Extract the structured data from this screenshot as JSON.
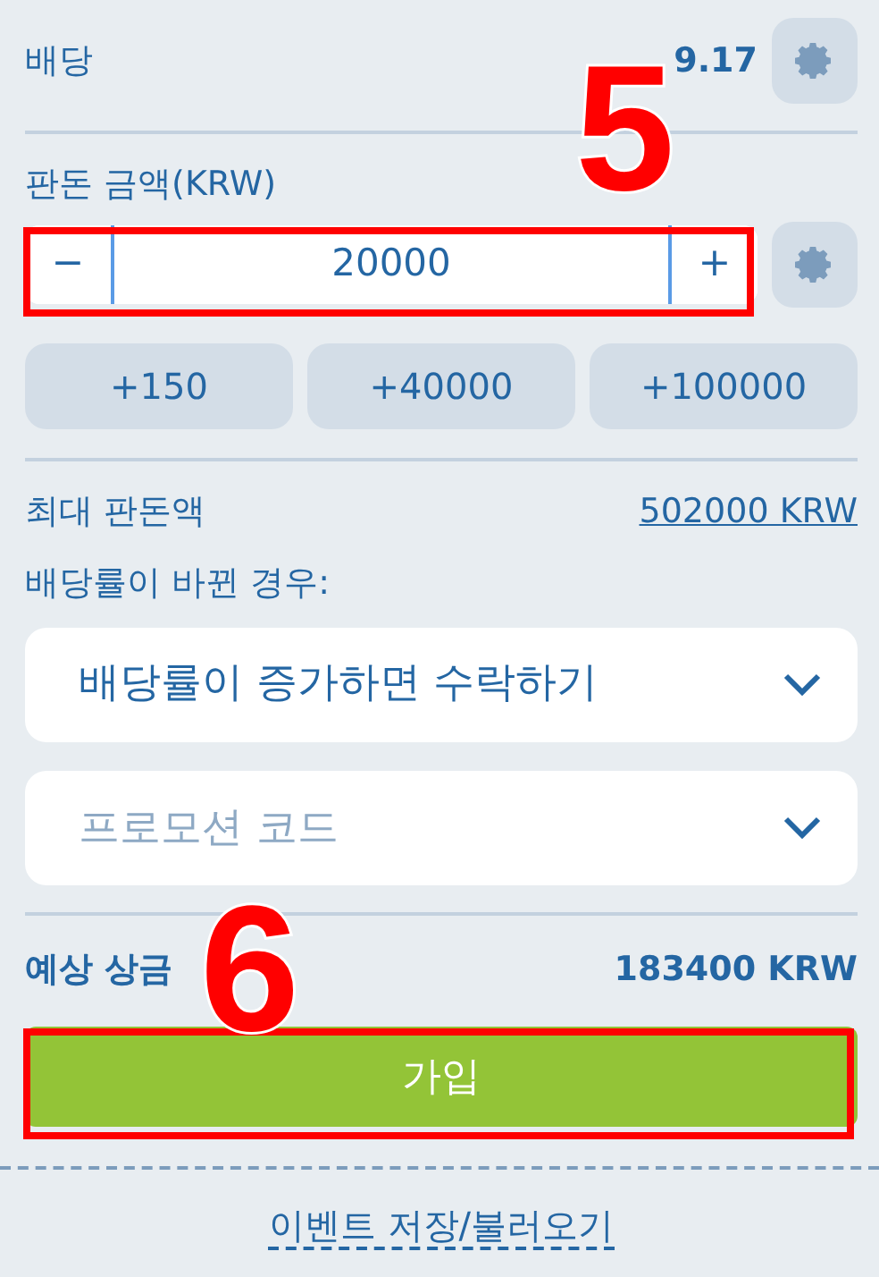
{
  "odds": {
    "label": "배당",
    "value": "9.17"
  },
  "stake": {
    "label": "판돈 금액(KRW)",
    "minus": "−",
    "value": "20000",
    "plus": "+"
  },
  "quick_amounts": [
    "+150",
    "+40000",
    "+100000"
  ],
  "max_stake": {
    "label": "최대 판돈액",
    "value": "502000 KRW"
  },
  "odds_change": {
    "label": "배당률이 바뀐 경우:",
    "value": "배당률이 증가하면 수락하기"
  },
  "promo_code": {
    "placeholder": "프로모션 코드"
  },
  "potential_win": {
    "label": "예상 상금",
    "value": "183400 KRW"
  },
  "submit": {
    "label": "가입"
  },
  "save_load_link": "이벤트 저장/불러오기",
  "annotations": [
    {
      "label": "5"
    },
    {
      "label": "6"
    }
  ]
}
